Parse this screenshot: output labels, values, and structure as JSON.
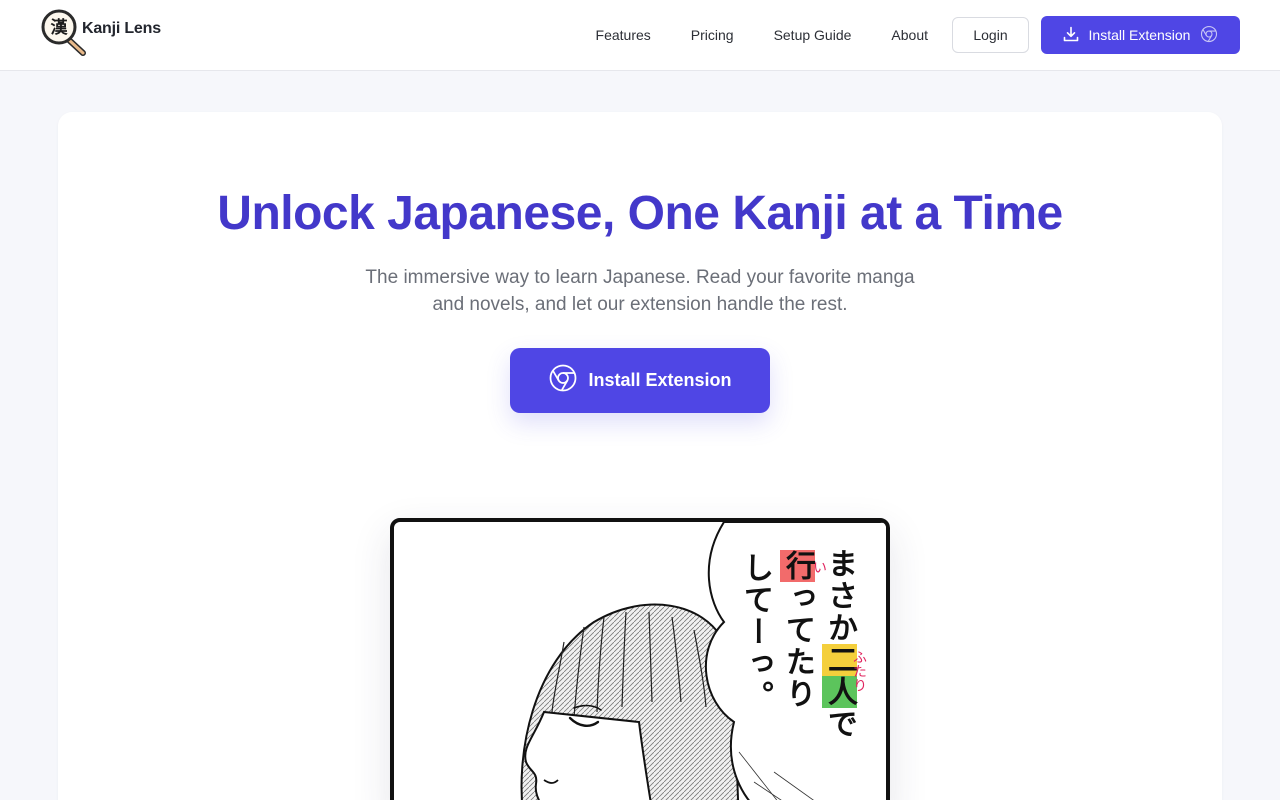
{
  "brand": {
    "name": "Kanji Lens",
    "logo_glyph": "漢"
  },
  "nav": {
    "links": [
      "Features",
      "Pricing",
      "Setup Guide",
      "About"
    ],
    "login_label": "Login",
    "install_label": "Install Extension"
  },
  "hero": {
    "title": "Unlock Japanese, One Kanji at a Time",
    "subtitle_line1": "The immersive way to learn Japanese. Read your favorite manga",
    "subtitle_line2": "and novels, and let our extension handle the rest.",
    "cta_label": "Install Extension"
  },
  "manga": {
    "col1": "まさか",
    "col1_b": "二",
    "col1_c": "人",
    "col1_d": "で",
    "col2_kanji": "行",
    "col2_rest": "ってたり",
    "col3": "してーっ。",
    "ruby_iku": "い",
    "ruby_futari": "ふたり"
  },
  "colors": {
    "accent": "#4f46e5",
    "title": "#4338ca",
    "highlight_red": "#f26b6b",
    "highlight_green": "#5cc45c",
    "highlight_yellow": "#f4cf3c"
  }
}
